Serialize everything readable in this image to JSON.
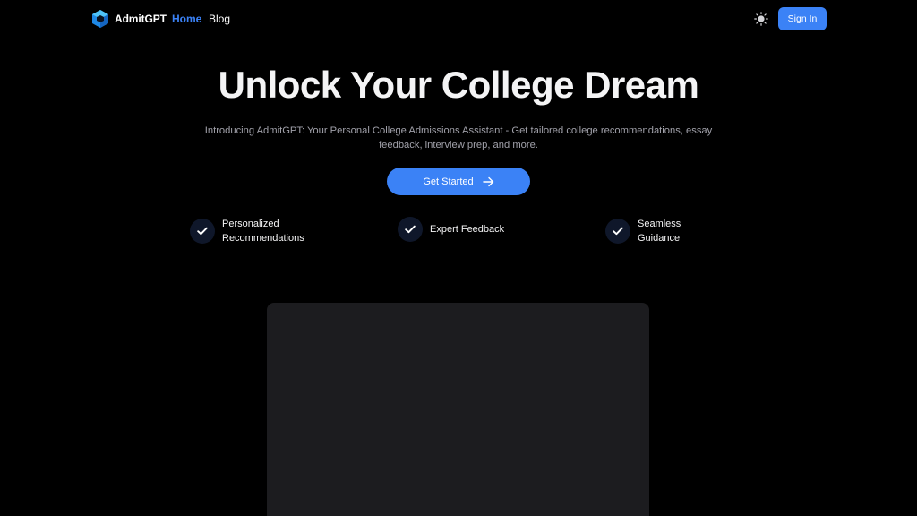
{
  "nav": {
    "brand": "AdmitGPT",
    "links": [
      {
        "label": "Home",
        "active": true
      },
      {
        "label": "Blog",
        "active": false
      }
    ],
    "theme_icon": "sun-icon",
    "signin_label": "Sign In"
  },
  "hero": {
    "title": "Unlock Your College Dream",
    "subtitle": "Introducing AdmitGPT: Your Personal College Admissions Assistant - Get tailored college recommendations, essay feedback, interview prep, and more.",
    "cta_label": "Get Started",
    "cta_icon": "arrow-right-icon"
  },
  "features": [
    {
      "label": "Personalized Recommendations",
      "icon": "check-icon"
    },
    {
      "label": "Expert Feedback",
      "icon": "check-icon"
    },
    {
      "label": "Seamless Guidance",
      "icon": "check-icon"
    }
  ],
  "colors": {
    "background": "#000000",
    "accent": "#3b82f6",
    "muted_text": "#a1a1aa",
    "check_circle": "#0f172a",
    "preview_bg": "#1c1c1f"
  }
}
